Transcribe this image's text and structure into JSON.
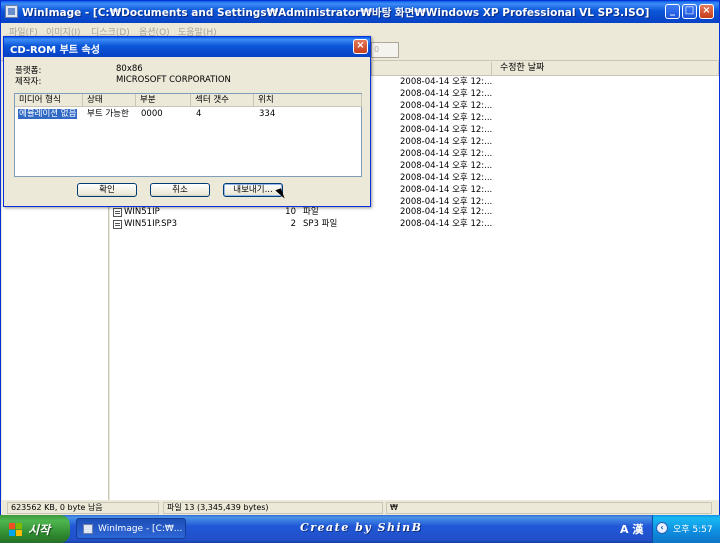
{
  "window": {
    "title": "WinImage - [C:₩Documents and Settings₩Administrator₩바탕 화면₩Windows XP Professional VL SP3.ISO]",
    "minimize": "_",
    "maximize": "□",
    "close": "×"
  },
  "menu": [
    {
      "label": "파일(F)"
    },
    {
      "label": "이미지(I)"
    },
    {
      "label": "디스크(D)"
    },
    {
      "label": "옵션(O)"
    },
    {
      "label": "도움말(H)"
    }
  ],
  "toolbar": {
    "fragment": "0"
  },
  "list": {
    "headers": {
      "date": "수정한 날짜"
    },
    "dates": [
      "2008-04-14  오후 12:...",
      "2008-04-14  오후 12:...",
      "2008-04-14  오후 12:...",
      "2008-04-14  오후 12:...",
      "2008-04-14  오후 12:...",
      "2008-04-14  오후 12:...",
      "2008-04-14  오후 12:...",
      "2008-04-14  오후 12:...",
      "2008-04-14  오후 12:...",
      "2008-04-14  오후 12:...",
      "2008-04-14  오후 12:...",
      "2008-04-14  오후 12:..."
    ],
    "files": [
      {
        "name": "WIN51IP",
        "size": "10",
        "type": "파일",
        "date": "2008-04-14  오후 12:..."
      },
      {
        "name": "WIN51IP.SP3",
        "size": "2",
        "type": "SP3 파일",
        "date": "2008-04-14  오후 12:..."
      }
    ]
  },
  "status": {
    "free": "623562 KB, 0 byte 남음",
    "files": "파일 13 (3,345,439 bytes)",
    "won": "₩"
  },
  "dialog": {
    "title": "CD-ROM 부트 속성",
    "close": "×",
    "platform_label": "플랫폼:",
    "platform_value": "80x86",
    "maker_label": "제작자:",
    "maker_value": "MICROSOFT CORPORATION",
    "columns": [
      "미디어 형식",
      "상태",
      "부분",
      "섹터 갯수",
      "위치"
    ],
    "row": {
      "media": "에뮬레이션 없음",
      "state": "부트 가능한",
      "part": "0000",
      "sectors": "4",
      "location": "334"
    },
    "ok": "확인",
    "cancel": "취소",
    "export": "내보내기..."
  },
  "taskbar": {
    "start": "시작",
    "task": "WinImage - [C:₩...",
    "credit": "Create by ShinB",
    "lang": "A 漢",
    "clock": "오후 5:57"
  },
  "colors": {
    "title_blue": "#0b56d8",
    "selection": "#316ac5",
    "start_green": "#3c9a3c",
    "face": "#ece9d8"
  }
}
